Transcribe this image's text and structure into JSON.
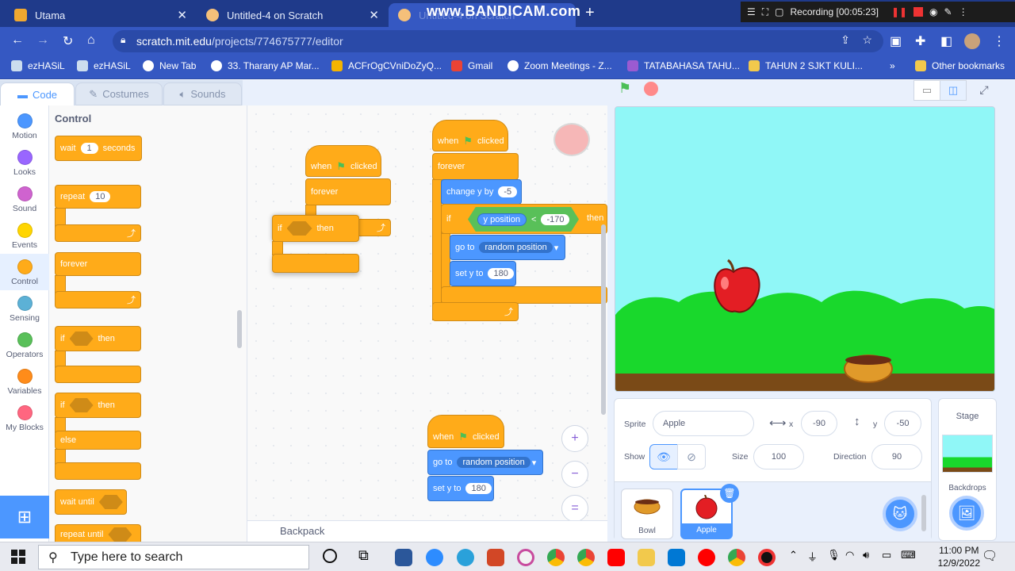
{
  "browser": {
    "tabs": [
      {
        "title": "Utama",
        "icon_color": "#f0a830"
      },
      {
        "title": "Untitled-4 on Scratch",
        "icon_color": "#f5c07a"
      },
      {
        "title": "Untitled-4 on Scratch",
        "icon_color": "#f5c07a"
      }
    ],
    "watermark": "www.BANDICAM.com",
    "recording": "Recording [00:05:23]",
    "url_host": "scratch.mit.edu",
    "url_path": "/projects/774675777/editor",
    "bookmarks": [
      "ezHASiL",
      "ezHASiL",
      "New Tab",
      "33. Tharany AP Mar...",
      "ACFrOgCVniDoZyQ...",
      "Gmail",
      "Zoom Meetings - Z...",
      "TATABAHASA TAHU...",
      "TAHUN 2 SJKT KULI...",
      "»",
      "Other bookmarks"
    ]
  },
  "editor_tabs": {
    "code": "Code",
    "costumes": "Costumes",
    "sounds": "Sounds"
  },
  "categories": [
    {
      "label": "Motion",
      "color": "#4c97ff"
    },
    {
      "label": "Looks",
      "color": "#9966ff"
    },
    {
      "label": "Sound",
      "color": "#cf63cf"
    },
    {
      "label": "Events",
      "color": "#ffd500"
    },
    {
      "label": "Control",
      "color": "#ffab19"
    },
    {
      "label": "Sensing",
      "color": "#5cb1d6"
    },
    {
      "label": "Operators",
      "color": "#59c059"
    },
    {
      "label": "Variables",
      "color": "#ff8c1a"
    },
    {
      "label": "My Blocks",
      "color": "#ff6680"
    }
  ],
  "palette": {
    "title": "Control",
    "wait": "wait",
    "wait_val": "1",
    "seconds": "seconds",
    "repeat": "repeat",
    "repeat_val": "10",
    "forever": "forever",
    "if": "if",
    "then": "then",
    "else": "else",
    "wait_until": "wait until",
    "repeat_until": "repeat until"
  },
  "scripts": {
    "when": "when",
    "clicked": "clicked",
    "forever": "forever",
    "if": "if",
    "then": "then",
    "change_y": "change y by",
    "change_y_val": "-5",
    "y_position": "y position",
    "lt": "<",
    "cmp_val": "-170",
    "go_to": "go to",
    "random_position": "random position",
    "set_y": "set y to",
    "set_y_val": "180",
    "then_cut": "then"
  },
  "workspace": {
    "backpack": "Backpack",
    "zoom_in": "+",
    "zoom_out": "−",
    "zoom_reset": "="
  },
  "sprite_info": {
    "sprite_label": "Sprite",
    "sprite_name": "Apple",
    "x_label": "x",
    "x_val": "-90",
    "y_label": "y",
    "y_val": "-50",
    "show_label": "Show",
    "size_label": "Size",
    "size_val": "100",
    "direction_label": "Direction",
    "direction_val": "90"
  },
  "sprites": [
    {
      "name": "Bowl"
    },
    {
      "name": "Apple"
    }
  ],
  "stage_panel": {
    "title": "Stage",
    "backdrops": "Backdrops"
  },
  "taskbar": {
    "search_placeholder": "Type here to search",
    "time": "11:00 PM",
    "date": "12/9/2022"
  },
  "colors": {
    "control": "#ffab19",
    "motion": "#4c97ff",
    "operators": "#59c059",
    "accent": "#4c97ff"
  }
}
